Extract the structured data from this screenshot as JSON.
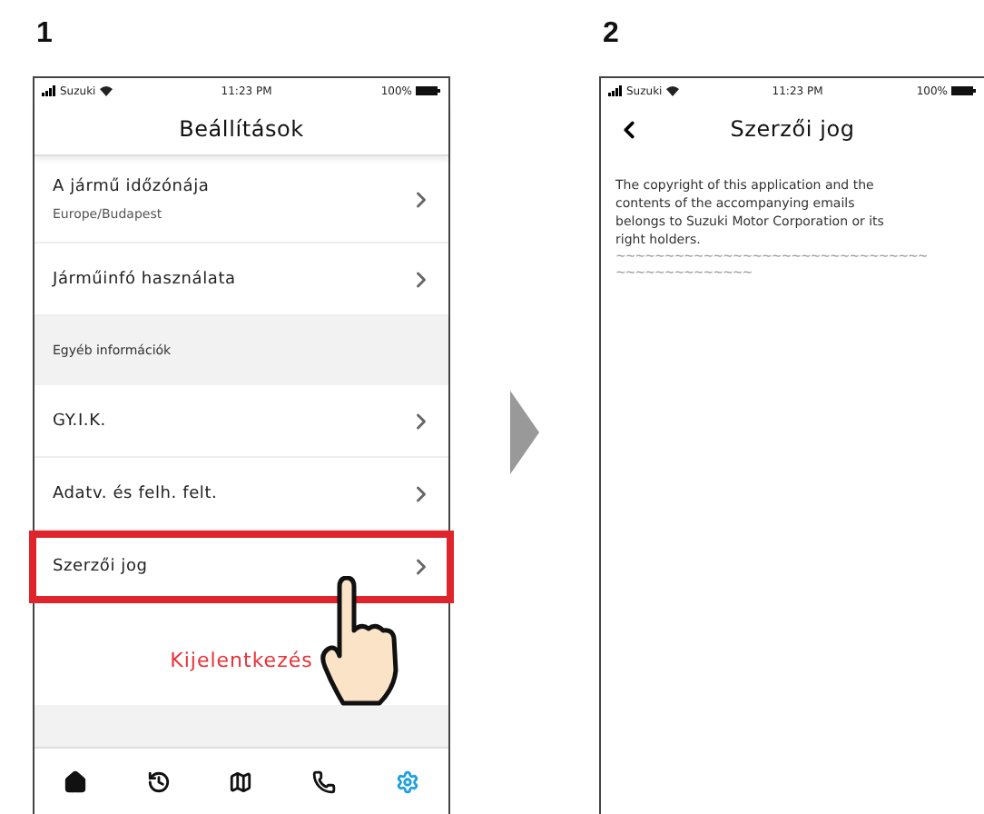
{
  "steps": [
    {
      "number": "1",
      "screen": {
        "kind": "menu",
        "status_bar": {
          "carrier": "Suzuki",
          "time": "11:23 PM",
          "battery": "100%"
        },
        "title": "Beállítások",
        "rows": [
          {
            "kind": "item",
            "label": "A jármű időzónája",
            "detail": "Europe/Budapest",
            "highlighted": false
          },
          {
            "kind": "item",
            "label": "Járműinfó használata",
            "highlighted": false
          },
          {
            "kind": "section",
            "label": "Egyéb információk"
          },
          {
            "kind": "item",
            "label": "GY.I.K.",
            "highlighted": false
          },
          {
            "kind": "item",
            "label": "Adatv. és felh. felt.",
            "highlighted": false
          },
          {
            "kind": "item",
            "label": "Szerzői jog",
            "highlighted": true
          }
        ],
        "logout": "Kijelentkezés",
        "tabs": [
          {
            "kind": "home",
            "selected": false
          },
          {
            "kind": "history",
            "selected": false
          },
          {
            "kind": "map",
            "selected": false
          },
          {
            "kind": "phone",
            "selected": false
          },
          {
            "kind": "settings",
            "selected": true
          }
        ]
      }
    },
    {
      "number": "2",
      "screen": {
        "kind": "page",
        "status_bar": {
          "carrier": "Suzuki",
          "time": "11:23 PM",
          "battery": "100%"
        },
        "title": "Szerzői jog",
        "body_lines": [
          "The copyright of this application and the",
          "contents of the accompanying emails",
          "belongs to Suzuki Motor Corporation or its",
          "right holders."
        ],
        "tilde_lines": [
          "~~~~~~~~~~~~~~~~~~~~~~~~~~~~~~~~",
          "~~~~~~~~~~~~~~"
        ]
      }
    }
  ]
}
